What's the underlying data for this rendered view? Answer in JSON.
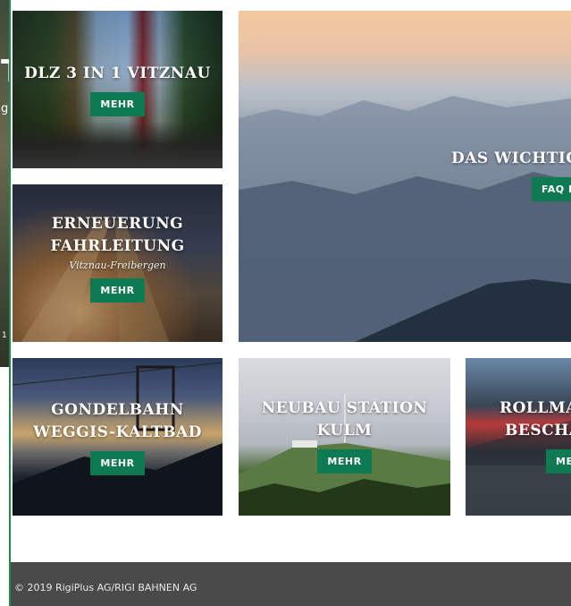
{
  "left_edge": {
    "glyph_big": "T",
    "glyph_small": "g",
    "glyph_tiny": "1"
  },
  "tiles": {
    "dlz": {
      "title": "DLZ 3 IN 1 VITZNAU",
      "button": "MEHR"
    },
    "faq": {
      "title": "DAS WICHTIG",
      "button": "FAQ L"
    },
    "fahrleitung": {
      "title_line1": "ERNEUERUNG",
      "title_line2": "FAHRLEITUNG",
      "subtitle": "Vitznau-Freibergen",
      "button": "MEHR"
    },
    "gondelbahn": {
      "title_line1": "GONDELBAHN",
      "title_line2": "WEGGIS-KALTBAD",
      "button": "MEHR"
    },
    "kulm": {
      "title_line1": "NEUBAU STATION",
      "title_line2": "KULM",
      "button": "MEHR"
    },
    "rollma": {
      "title_line1": "ROLLMA",
      "title_line2": "BESCHA",
      "button": "ME"
    }
  },
  "footer": {
    "copyright": "© 2019 RigiPlus AG/RIGI BAHNEN AG"
  },
  "colors": {
    "accent_green": "#0d7a52",
    "footer_bg": "#4a4a4a",
    "edge_line": "#1f8a4c"
  }
}
